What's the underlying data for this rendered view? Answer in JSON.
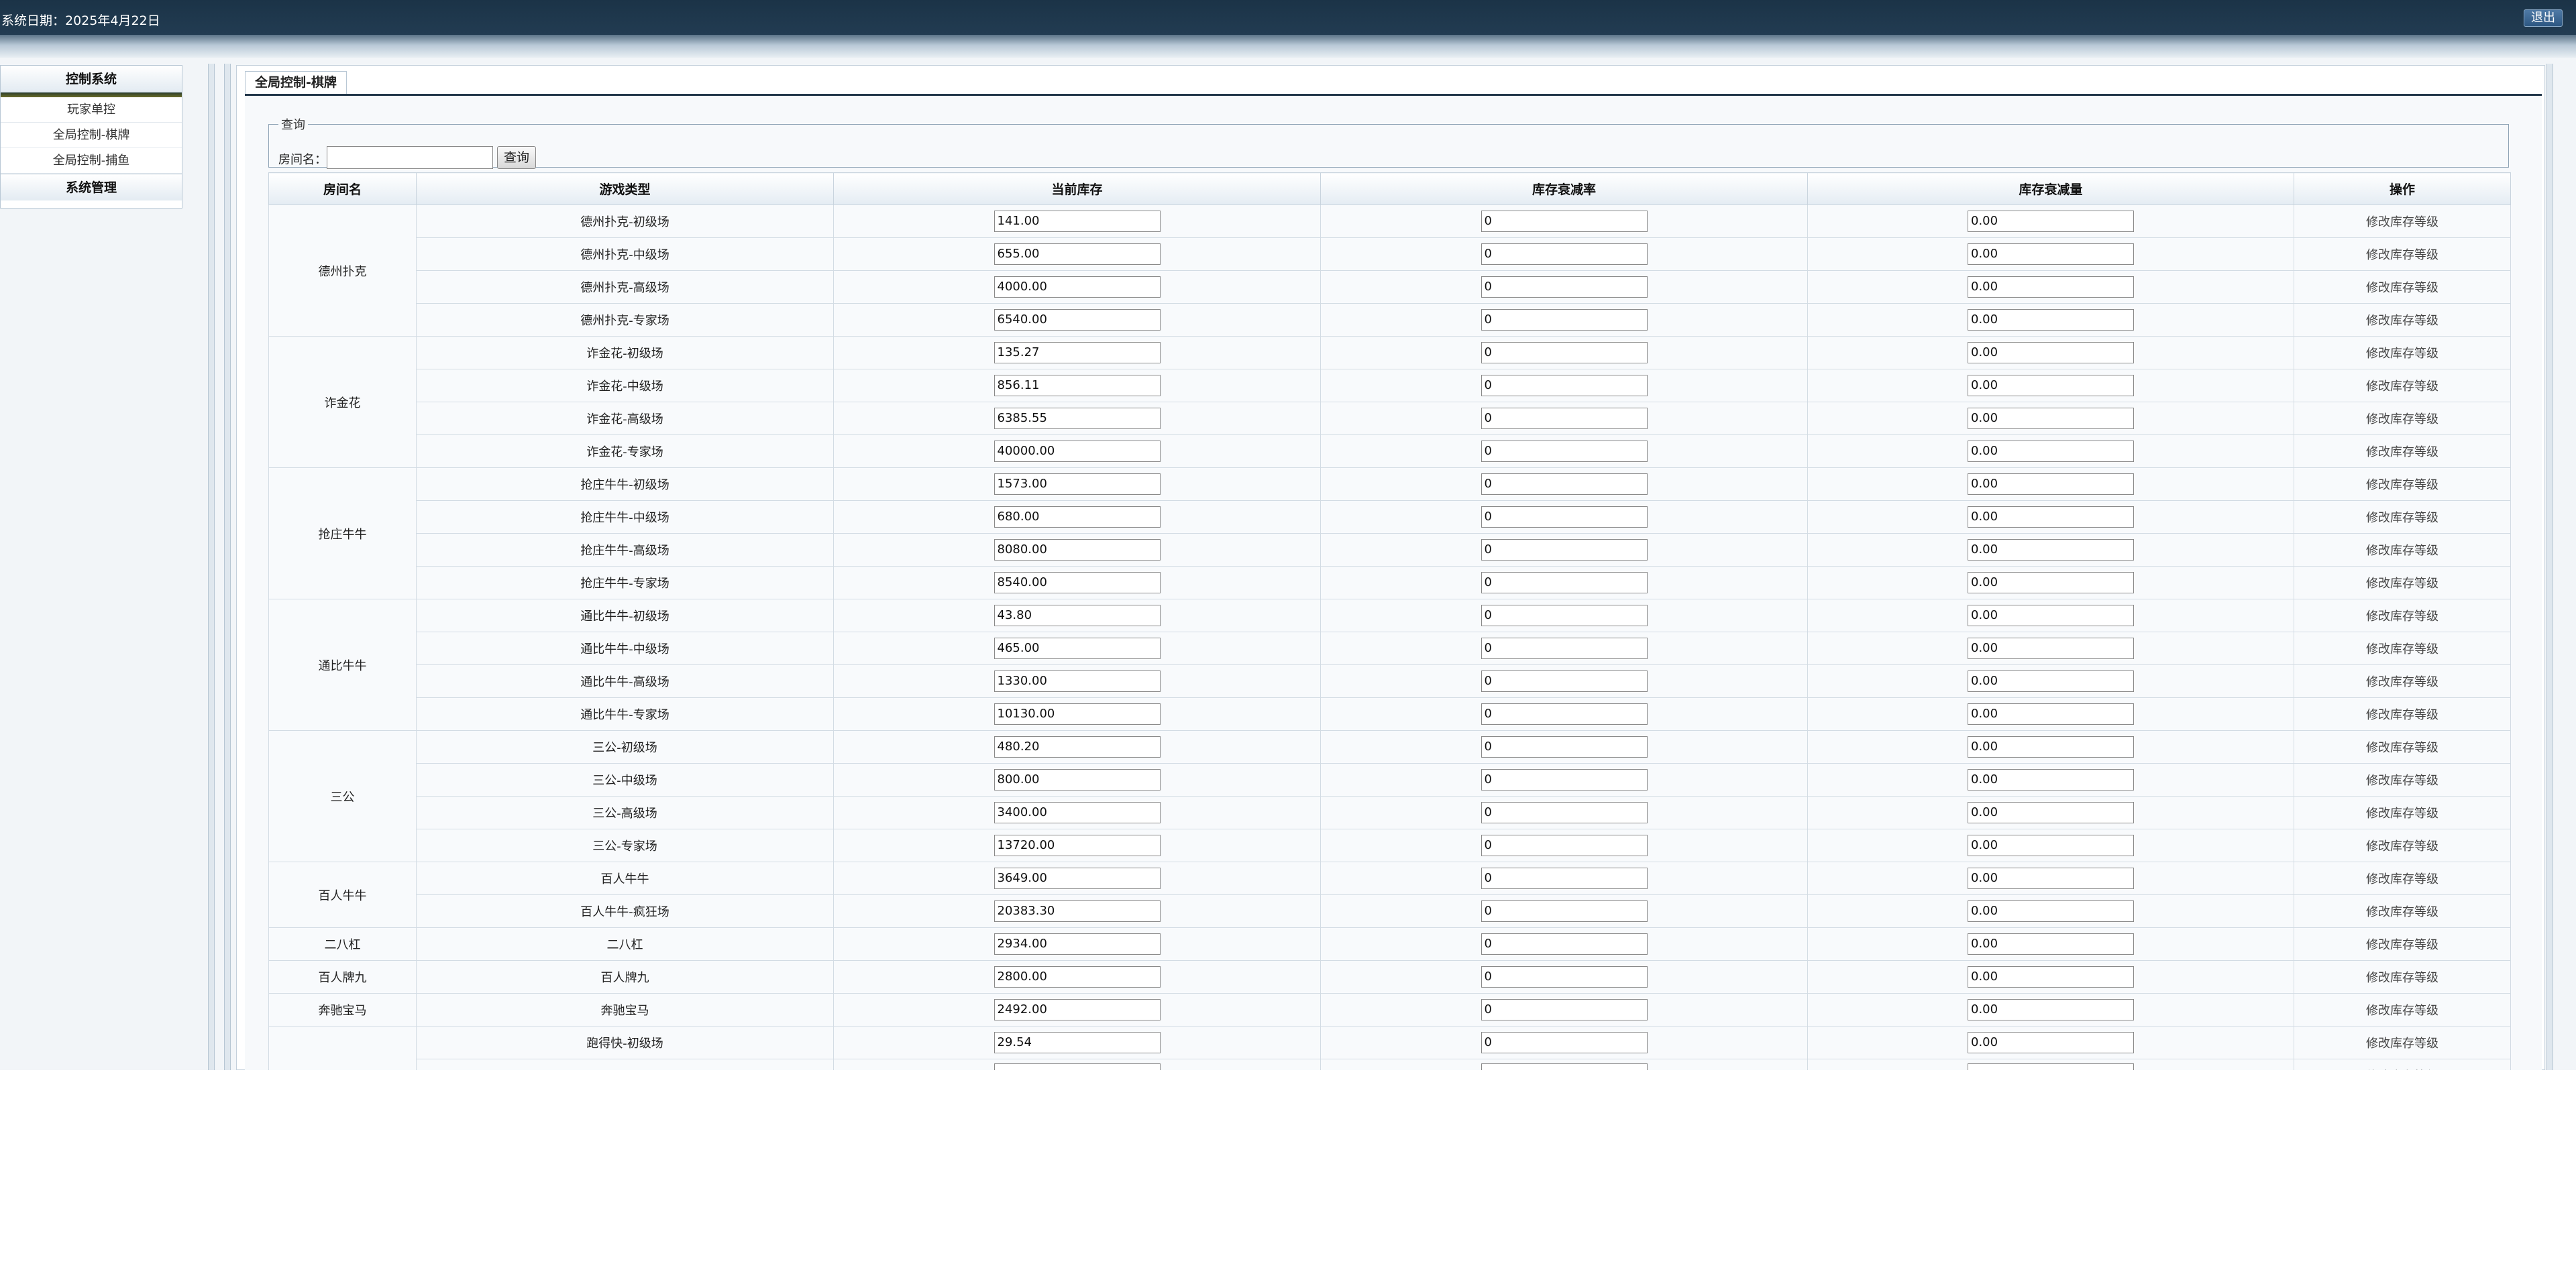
{
  "topbar": {
    "date_label": "系统日期：2025年4月22日",
    "logout_label": "退出"
  },
  "sidebar": {
    "title": "控制系统",
    "items": [
      "玩家单控",
      "全局控制-棋牌",
      "全局控制-捕鱼"
    ],
    "section2": "系统管理"
  },
  "panel": {
    "tab_title": "全局控制-棋牌"
  },
  "query": {
    "legend": "查询",
    "label": "房间名：",
    "input_value": "",
    "button_label": "查询"
  },
  "table": {
    "headers": [
      "房间名",
      "游戏类型",
      "当前库存",
      "库存衰减率",
      "库存衰减量",
      "操作"
    ],
    "action_label": "修改库存等级",
    "groups": [
      {
        "room": "德州扑克",
        "rows": [
          {
            "type": "德州扑克-初级场",
            "stock": "141.00",
            "rate": "0",
            "amount": "0.00"
          },
          {
            "type": "德州扑克-中级场",
            "stock": "655.00",
            "rate": "0",
            "amount": "0.00"
          },
          {
            "type": "德州扑克-高级场",
            "stock": "4000.00",
            "rate": "0",
            "amount": "0.00"
          },
          {
            "type": "德州扑克-专家场",
            "stock": "6540.00",
            "rate": "0",
            "amount": "0.00"
          }
        ]
      },
      {
        "room": "诈金花",
        "rows": [
          {
            "type": "诈金花-初级场",
            "stock": "135.27",
            "rate": "0",
            "amount": "0.00"
          },
          {
            "type": "诈金花-中级场",
            "stock": "856.11",
            "rate": "0",
            "amount": "0.00"
          },
          {
            "type": "诈金花-高级场",
            "stock": "6385.55",
            "rate": "0",
            "amount": "0.00"
          },
          {
            "type": "诈金花-专家场",
            "stock": "40000.00",
            "rate": "0",
            "amount": "0.00"
          }
        ]
      },
      {
        "room": "抢庄牛牛",
        "rows": [
          {
            "type": "抢庄牛牛-初级场",
            "stock": "1573.00",
            "rate": "0",
            "amount": "0.00"
          },
          {
            "type": "抢庄牛牛-中级场",
            "stock": "680.00",
            "rate": "0",
            "amount": "0.00"
          },
          {
            "type": "抢庄牛牛-高级场",
            "stock": "8080.00",
            "rate": "0",
            "amount": "0.00"
          },
          {
            "type": "抢庄牛牛-专家场",
            "stock": "8540.00",
            "rate": "0",
            "amount": "0.00"
          }
        ]
      },
      {
        "room": "通比牛牛",
        "rows": [
          {
            "type": "通比牛牛-初级场",
            "stock": "43.80",
            "rate": "0",
            "amount": "0.00"
          },
          {
            "type": "通比牛牛-中级场",
            "stock": "465.00",
            "rate": "0",
            "amount": "0.00"
          },
          {
            "type": "通比牛牛-高级场",
            "stock": "1330.00",
            "rate": "0",
            "amount": "0.00"
          },
          {
            "type": "通比牛牛-专家场",
            "stock": "10130.00",
            "rate": "0",
            "amount": "0.00"
          }
        ]
      },
      {
        "room": "三公",
        "rows": [
          {
            "type": "三公-初级场",
            "stock": "480.20",
            "rate": "0",
            "amount": "0.00"
          },
          {
            "type": "三公-中级场",
            "stock": "800.00",
            "rate": "0",
            "amount": "0.00"
          },
          {
            "type": "三公-高级场",
            "stock": "3400.00",
            "rate": "0",
            "amount": "0.00"
          },
          {
            "type": "三公-专家场",
            "stock": "13720.00",
            "rate": "0",
            "amount": "0.00"
          }
        ]
      },
      {
        "room": "百人牛牛",
        "rows": [
          {
            "type": "百人牛牛",
            "stock": "3649.00",
            "rate": "0",
            "amount": "0.00"
          },
          {
            "type": "百人牛牛-疯狂场",
            "stock": "20383.30",
            "rate": "0",
            "amount": "0.00"
          }
        ]
      },
      {
        "room": "二八杠",
        "rows": [
          {
            "type": "二八杠",
            "stock": "2934.00",
            "rate": "0",
            "amount": "0.00"
          }
        ]
      },
      {
        "room": "百人牌九",
        "rows": [
          {
            "type": "百人牌九",
            "stock": "2800.00",
            "rate": "0",
            "amount": "0.00"
          }
        ]
      },
      {
        "room": "奔驰宝马",
        "rows": [
          {
            "type": "奔驰宝马",
            "stock": "2492.00",
            "rate": "0",
            "amount": "0.00"
          }
        ]
      },
      {
        "room": "",
        "rows": [
          {
            "type": "跑得快-初级场",
            "stock": "29.54",
            "rate": "0",
            "amount": "0.00"
          },
          {
            "type": "",
            "stock": "",
            "rate": "",
            "amount": ""
          }
        ]
      }
    ]
  }
}
